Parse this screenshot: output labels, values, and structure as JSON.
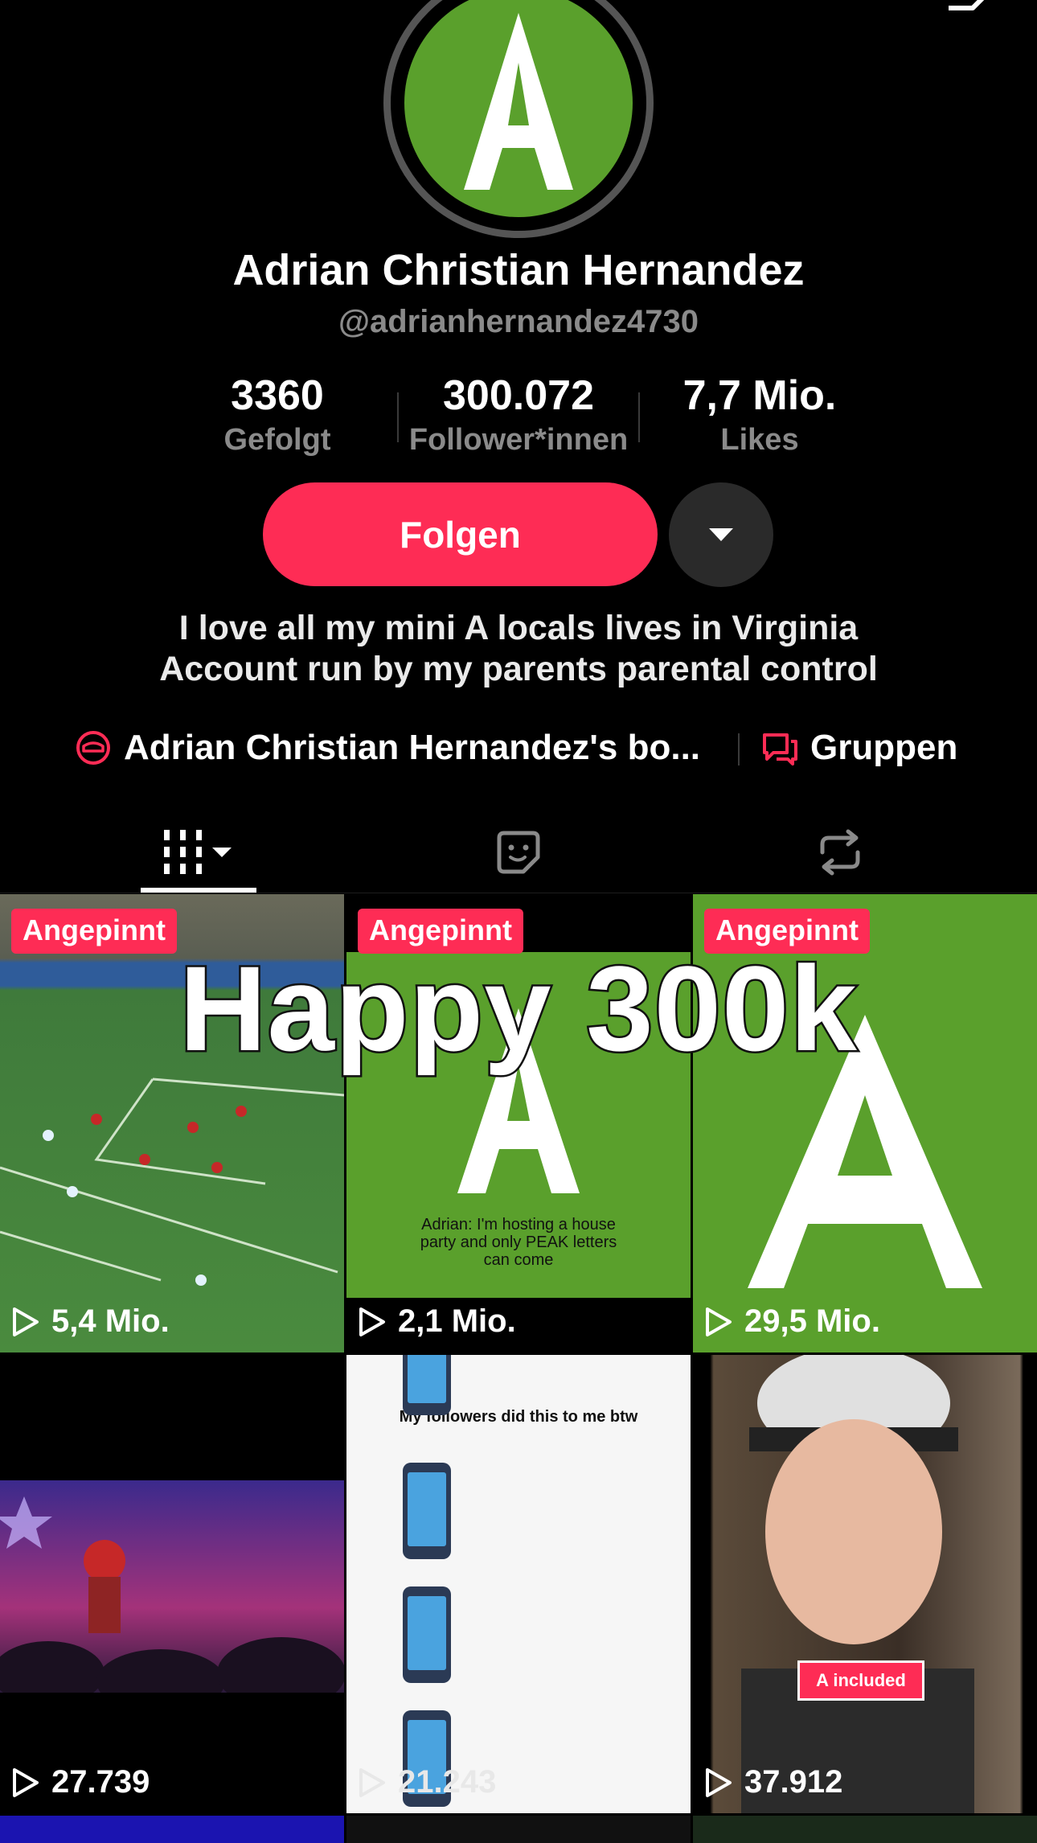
{
  "profile": {
    "display_name": "Adrian Christian Hernandez",
    "handle": "@adrianhernandez4730",
    "avatar_letter": "A",
    "avatar_color": "#5aa02c"
  },
  "stats": [
    {
      "value": "3360",
      "label": "Gefolgt"
    },
    {
      "value": "300.072",
      "label": "Follower*innen"
    },
    {
      "value": "7,7 Mio.",
      "label": "Likes"
    }
  ],
  "actions": {
    "follow_label": "Folgen",
    "accent_color": "#fe2c55"
  },
  "bio": {
    "line1": "I love all my mini A locals lives in Virginia",
    "line2": "Account run by my parents parental control"
  },
  "links": {
    "showcase_label": "Adrian Christian Hernandez's bo...",
    "groups_label": "Gruppen"
  },
  "overlay": {
    "text": "Happy 300k"
  },
  "videos": [
    {
      "pinned": "Angepinnt",
      "views": "5,4 Mio."
    },
    {
      "pinned": "Angepinnt",
      "views": "2,1 Mio.",
      "caption": "Adrian: I'm hosting a house party and only PEAK letters can come"
    },
    {
      "pinned": "Angepinnt",
      "views": "29,5 Mio."
    },
    {
      "views": "27.739"
    },
    {
      "views": "21.243",
      "caption": "My followers did this to me btw"
    },
    {
      "views": "37.912",
      "tag": "A included"
    }
  ],
  "icons": [
    "back-icon",
    "bell-icon",
    "share-icon",
    "dropdown-caret-icon",
    "showcase-icon",
    "groups-icon",
    "grid-icon",
    "sticker-icon",
    "repost-icon",
    "play-icon"
  ]
}
